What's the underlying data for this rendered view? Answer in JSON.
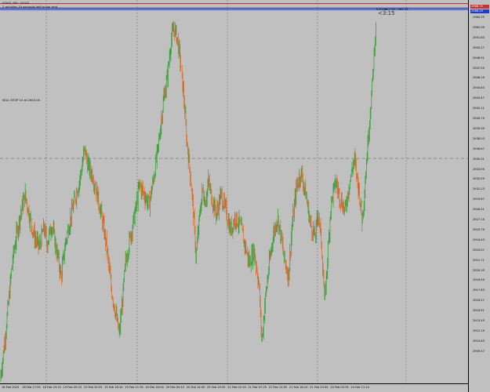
{
  "header": {
    "symbol_line": "GOLD, M5 : GOLD",
    "countdown_line": "2 minutes 19 seconds left to bar end"
  },
  "sell_stop_label": "SELL STOP 10 at 2943.05",
  "top_right": {
    "info_line": "0.0 pips / 15 : 163.15",
    "countdown_large": "<3:15"
  },
  "badges": {
    "ask": "2966.75",
    "bid": "2966.29"
  },
  "colors": {
    "background": "#c0c0c0",
    "bull_candle": "#2c9b2c",
    "bear_candle": "#d9641c",
    "ask_line": "#c83232",
    "bid_line": "#1e3cc8",
    "grid": "#808080"
  },
  "price_axis_labels": [
    "2964.35",
    "2962.99",
    "2951.63",
    "2950.27",
    "2948.91",
    "2947.55",
    "2946.19",
    "2944.83",
    "2943.47",
    "2942.11",
    "2940.75",
    "2939.39",
    "2938.03",
    "2936.67",
    "2935.31",
    "2933.95",
    "2932.59",
    "2931.23",
    "2929.87",
    "2928.51",
    "2927.15",
    "2925.79",
    "2924.43",
    "2923.07",
    "2921.71",
    "2920.35",
    "2918.99",
    "2917.63",
    "2916.27",
    "2914.91",
    "2913.55",
    "2912.19",
    "2910.83",
    "2909.47"
  ],
  "time_axis_labels": [
    "18 Feb 2025",
    "18 Feb 17:55",
    "18 Feb 23:10",
    "19 Feb 05:25",
    "19 Feb 10:55",
    "19 Feb 16:10",
    "19 Feb 21:35",
    "20 Feb 03:00",
    "20 Feb 09:10",
    "20 Feb 14:30",
    "20 Feb 19:55",
    "21 Feb 02:10",
    "21 Feb 07:25",
    "21 Feb 12:55",
    "21 Feb 18:10",
    "21 Feb 23:35",
    "24 Feb 05:35",
    "24 Feb 11:10"
  ],
  "chart_data": {
    "type": "candlestick",
    "ylim": [
      2908.6,
      2967.3
    ],
    "bull_color": "#2c9b2c",
    "bear_color": "#d9641c",
    "close_path": [
      [
        0,
        2909.0
      ],
      [
        5,
        2914.0
      ],
      [
        10,
        2920.0
      ],
      [
        16,
        2927.5
      ],
      [
        22,
        2932.0
      ],
      [
        26,
        2934.5
      ],
      [
        32,
        2937.5
      ],
      [
        38,
        2934.0
      ],
      [
        44,
        2931.0
      ],
      [
        50,
        2929.5
      ],
      [
        56,
        2932.5
      ],
      [
        60,
        2930.0
      ],
      [
        66,
        2933.0
      ],
      [
        72,
        2929.0
      ],
      [
        78,
        2925.0
      ],
      [
        84,
        2930.5
      ],
      [
        90,
        2934.0
      ],
      [
        96,
        2937.0
      ],
      [
        102,
        2940.0
      ],
      [
        108,
        2944.5
      ],
      [
        112,
        2942.0
      ],
      [
        118,
        2940.5
      ],
      [
        124,
        2937.5
      ],
      [
        130,
        2934.0
      ],
      [
        136,
        2929.5
      ],
      [
        142,
        2923.0
      ],
      [
        148,
        2919.0
      ],
      [
        152,
        2916.0
      ],
      [
        156,
        2921.0
      ],
      [
        160,
        2927.0
      ],
      [
        166,
        2931.0
      ],
      [
        172,
        2934.5
      ],
      [
        178,
        2939.0
      ],
      [
        184,
        2937.5
      ],
      [
        190,
        2936.0
      ],
      [
        196,
        2940.0
      ],
      [
        202,
        2945.0
      ],
      [
        208,
        2951.5
      ],
      [
        214,
        2956.0
      ],
      [
        218,
        2961.0
      ],
      [
        222,
        2963.0
      ],
      [
        226,
        2961.5
      ],
      [
        230,
        2958.0
      ],
      [
        234,
        2953.0
      ],
      [
        238,
        2946.0
      ],
      [
        242,
        2941.5
      ],
      [
        246,
        2936.0
      ],
      [
        250,
        2928.0
      ],
      [
        254,
        2933.5
      ],
      [
        258,
        2938.0
      ],
      [
        262,
        2936.5
      ],
      [
        266,
        2939.5
      ],
      [
        270,
        2937.0
      ],
      [
        276,
        2934.5
      ],
      [
        282,
        2937.5
      ],
      [
        288,
        2935.0
      ],
      [
        294,
        2932.0
      ],
      [
        300,
        2934.0
      ],
      [
        306,
        2933.0
      ],
      [
        312,
        2930.0
      ],
      [
        318,
        2927.0
      ],
      [
        324,
        2929.0
      ],
      [
        330,
        2924.0
      ],
      [
        334,
        2915.0
      ],
      [
        338,
        2921.0
      ],
      [
        342,
        2925.5
      ],
      [
        348,
        2931.0
      ],
      [
        354,
        2934.0
      ],
      [
        358,
        2931.5
      ],
      [
        362,
        2928.0
      ],
      [
        368,
        2925.0
      ],
      [
        372,
        2932.0
      ],
      [
        378,
        2938.5
      ],
      [
        384,
        2941.0
      ],
      [
        390,
        2937.5
      ],
      [
        396,
        2933.0
      ],
      [
        402,
        2931.0
      ],
      [
        406,
        2935.0
      ],
      [
        410,
        2930.0
      ],
      [
        414,
        2921.0
      ],
      [
        418,
        2928.0
      ],
      [
        422,
        2936.0
      ],
      [
        428,
        2939.5
      ],
      [
        434,
        2937.0
      ],
      [
        440,
        2935.0
      ],
      [
        446,
        2939.5
      ],
      [
        452,
        2943.0
      ],
      [
        458,
        2938.0
      ],
      [
        462,
        2933.5
      ],
      [
        466,
        2940.0
      ],
      [
        470,
        2947.0
      ],
      [
        474,
        2953.0
      ],
      [
        478,
        2961.0
      ],
      [
        480,
        2964.0
      ]
    ],
    "sell_stop_price": 2943.05,
    "ask_price": 2966.75,
    "bid_price": 2966.29
  }
}
